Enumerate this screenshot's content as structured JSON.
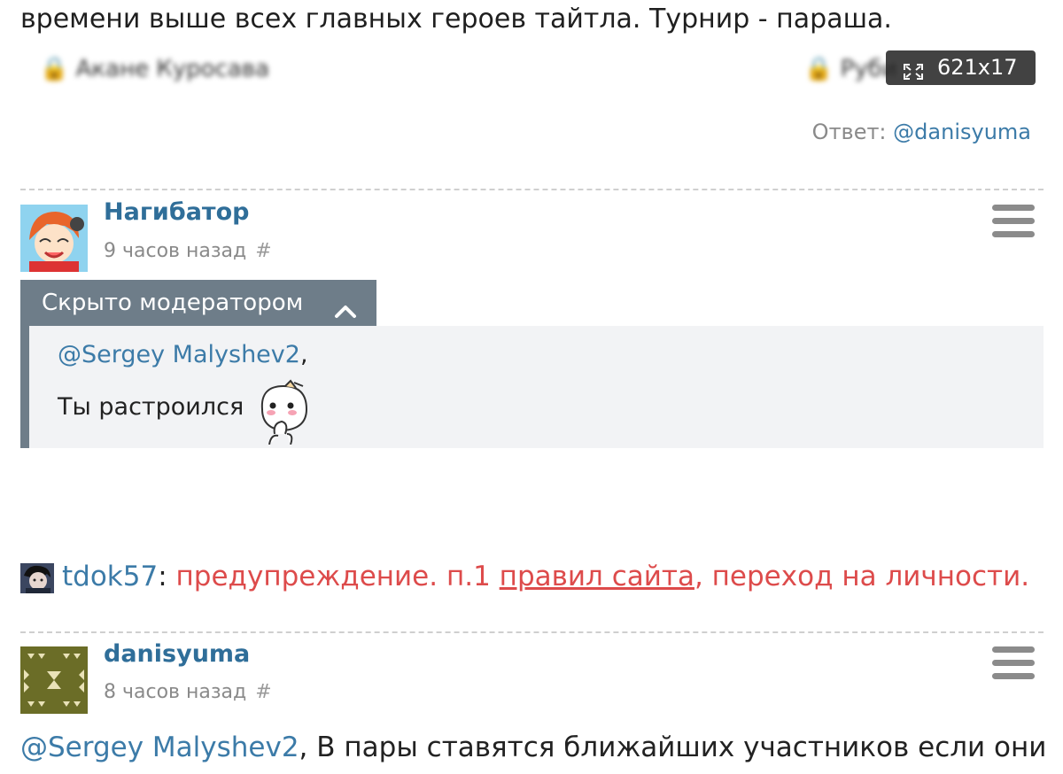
{
  "top_text": "времени выше всех главных героев тайтла. Турнир - параша.",
  "image_strip": {
    "left_name": "Акане Куросава",
    "right_name": "Руби",
    "badge_text": "621x17",
    "expand_icon": "expand-icon"
  },
  "reply": {
    "prefix": "Ответ:",
    "user": "@danisyuma"
  },
  "comment1": {
    "username": "Нагибатор",
    "time": "9 часов назад",
    "hash": "#",
    "moderation_label": "Скрыто модератором",
    "mention": "@Sergey Malyshev2",
    "mention_suffix": ",",
    "message": "Ты растроился",
    "emoji": "blushing-face-emoji"
  },
  "warning": {
    "moderator": "tdok57",
    "colon": ":",
    "text_before": "предупреждение. п.1",
    "rules_link": "правил сайта",
    "text_after": ", переход на личности."
  },
  "comment2": {
    "username": "danisyuma",
    "time": "8 часов назад",
    "hash": "#",
    "mention": "@Sergey Malyshev2",
    "text": ", В пары ставятся ближайших участников если они"
  },
  "colors": {
    "link": "#3c7ba8",
    "username": "#2f6e99",
    "warning": "#dd4b4b",
    "moderation_bar": "#6e7d89"
  }
}
